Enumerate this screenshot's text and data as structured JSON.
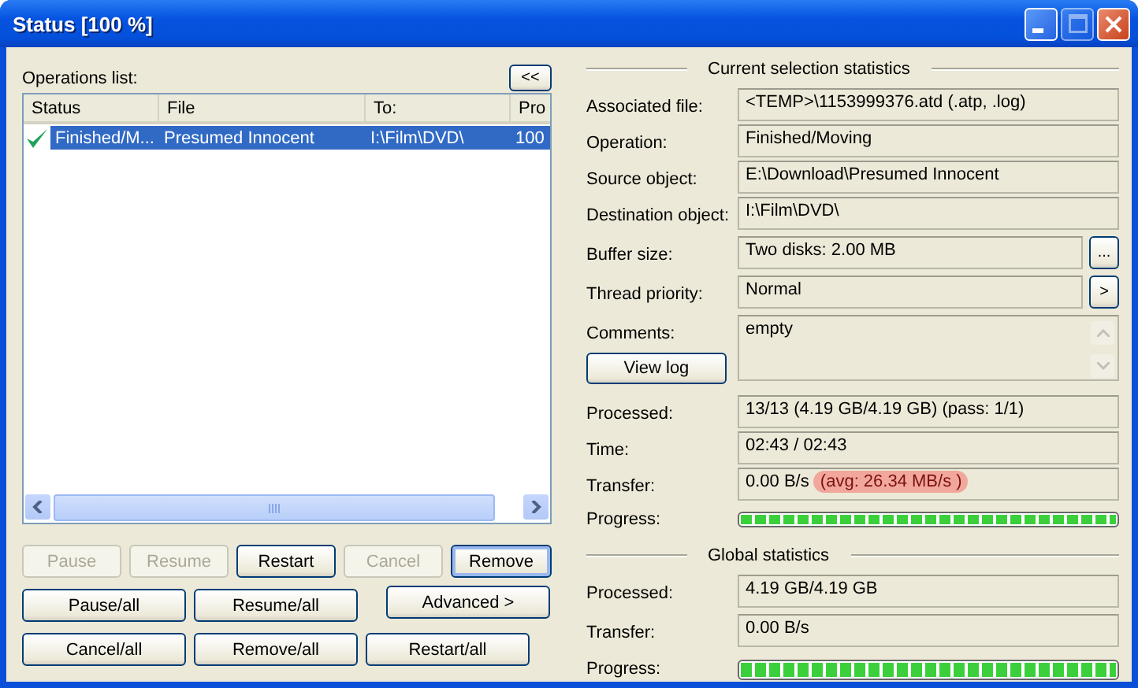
{
  "window": {
    "title": "Status [100 %]",
    "controls": [
      {
        "kind": "minimize",
        "disabled": false
      },
      {
        "kind": "maximize",
        "disabled": true
      },
      {
        "kind": "close",
        "disabled": false
      }
    ]
  },
  "operations": {
    "label": "Operations list:",
    "collapse_button": "<<",
    "columns": [
      "Status",
      "File",
      "To:",
      "Pro"
    ],
    "rows": [
      {
        "status": "Finished/M...",
        "done": true,
        "file": "Presumed Innocent",
        "to": "I:\\Film\\DVD\\",
        "progress": "100",
        "selected": true
      }
    ]
  },
  "buttons": [
    [
      {
        "label": "Pause",
        "disabled": true,
        "default": false
      },
      {
        "label": "Resume",
        "disabled": true,
        "default": false
      },
      {
        "label": "Restart",
        "disabled": false,
        "default": false
      },
      {
        "label": "Cancel",
        "disabled": true,
        "default": false
      },
      {
        "label": "Remove",
        "disabled": false,
        "default": true
      }
    ],
    [
      {
        "label": "Pause/all",
        "disabled": false,
        "default": false
      },
      {
        "label": "Resume/all",
        "disabled": false,
        "default": false
      },
      {
        "label": "Advanced >",
        "disabled": false,
        "default": false
      }
    ],
    [
      {
        "label": "Cancel/all",
        "disabled": false,
        "default": false
      },
      {
        "label": "Remove/all",
        "disabled": false,
        "default": false
      },
      {
        "label": "Restart/all",
        "disabled": false,
        "default": false
      }
    ]
  ],
  "current": {
    "heading": "Current selection statistics",
    "rows": [
      {
        "kind": "field",
        "label": "Associated file:",
        "value": "<TEMP>\\1153999376.atd (.atp, .log)"
      },
      {
        "kind": "field",
        "label": "Operation:",
        "value": "Finished/Moving"
      },
      {
        "kind": "field",
        "label": "Source object:",
        "value": "E:\\Download\\Presumed Innocent"
      },
      {
        "kind": "field",
        "label": "Destination object:",
        "value": "I:\\Film\\DVD\\"
      },
      {
        "kind": "field_button",
        "label": "Buffer size:",
        "value": "Two disks: 2.00 MB",
        "button": "..."
      },
      {
        "kind": "field_button",
        "label": "Thread priority:",
        "value": "Normal",
        "button": ">"
      },
      {
        "kind": "comments",
        "label": "Comments:",
        "value": "empty",
        "button": "View log"
      },
      {
        "kind": "field",
        "label": "Processed:",
        "value": "13/13 (4.19 GB/4.19 GB) (pass: 1/1)"
      },
      {
        "kind": "field",
        "label": "Time:",
        "value": "02:43 / 02:43"
      },
      {
        "kind": "transfer",
        "label": "Transfer:",
        "value": "0.00 B/s",
        "avg": "(avg: 26.34 MB/s )",
        "highlighted": true
      },
      {
        "kind": "progress",
        "label": "Progress:",
        "level": 1
      }
    ]
  },
  "global": {
    "heading": "Global statistics",
    "rows": [
      {
        "kind": "field",
        "label": "Processed:",
        "value": "4.19 GB/4.19 GB"
      },
      {
        "kind": "field",
        "label": "Transfer:",
        "value": "0.00 B/s"
      },
      {
        "kind": "progress",
        "label": "Progress:",
        "level": 1
      }
    ]
  }
}
